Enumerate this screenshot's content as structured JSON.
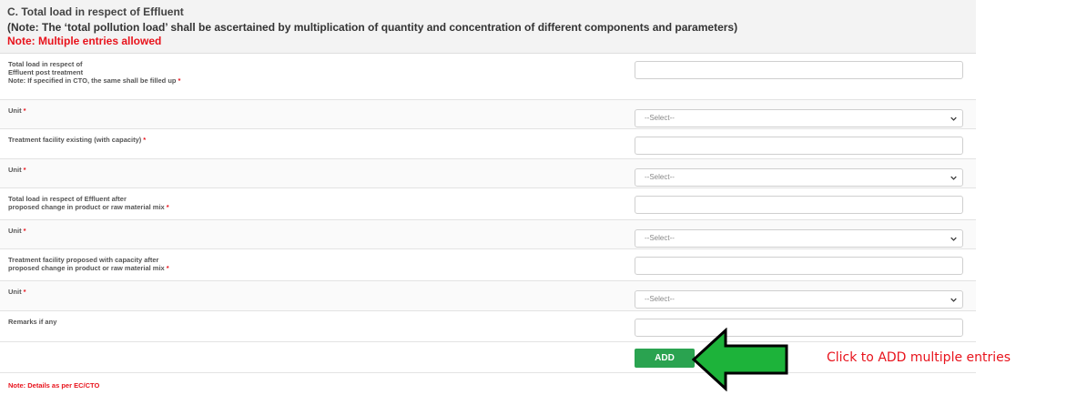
{
  "section": {
    "title": "C. Total load in respect of Effluent",
    "note": "(Note: The ‘total pollution load’ shall be ascertained by multiplication of quantity and concentration of different components and parameters)",
    "multiple_note": "Note: Multiple entries allowed"
  },
  "fields": [
    {
      "lines": [
        "Total load in respect of",
        "Effluent post treatment",
        "Note: If specified in CTO, the same shall be filled up"
      ],
      "required": true,
      "type": "text",
      "value": ""
    },
    {
      "lines": [
        "Unit"
      ],
      "required": true,
      "type": "select",
      "value": "--Select--"
    },
    {
      "lines": [
        "Treatment facility existing (with capacity)"
      ],
      "required": true,
      "type": "text",
      "value": ""
    },
    {
      "lines": [
        "Unit"
      ],
      "required": true,
      "type": "select",
      "value": "--Select--"
    },
    {
      "lines": [
        "Total load in respect of Effluent after",
        "proposed change in product or raw material mix"
      ],
      "required": true,
      "type": "text",
      "value": ""
    },
    {
      "lines": [
        "Unit"
      ],
      "required": true,
      "type": "select",
      "value": "--Select--"
    },
    {
      "lines": [
        "Treatment facility proposed with capacity after",
        "proposed change in product or raw material mix"
      ],
      "required": true,
      "type": "text",
      "value": ""
    },
    {
      "lines": [
        "Unit"
      ],
      "required": true,
      "type": "select",
      "value": "--Select--"
    },
    {
      "lines": [
        "Remarks if any"
      ],
      "required": false,
      "type": "text",
      "value": ""
    }
  ],
  "required_marker": "*",
  "add_button": "ADD",
  "footnote": "Note: Details as per EC/CTO",
  "callout": "Click to ADD multiple entries",
  "icons": {
    "select_arrow": "chevron-down-icon",
    "pointer": "left-arrow-icon"
  },
  "colors": {
    "add_button": "#2aa350",
    "required": "#e8131c",
    "arrow_fill": "#1db33a",
    "arrow_stroke": "#000000"
  }
}
